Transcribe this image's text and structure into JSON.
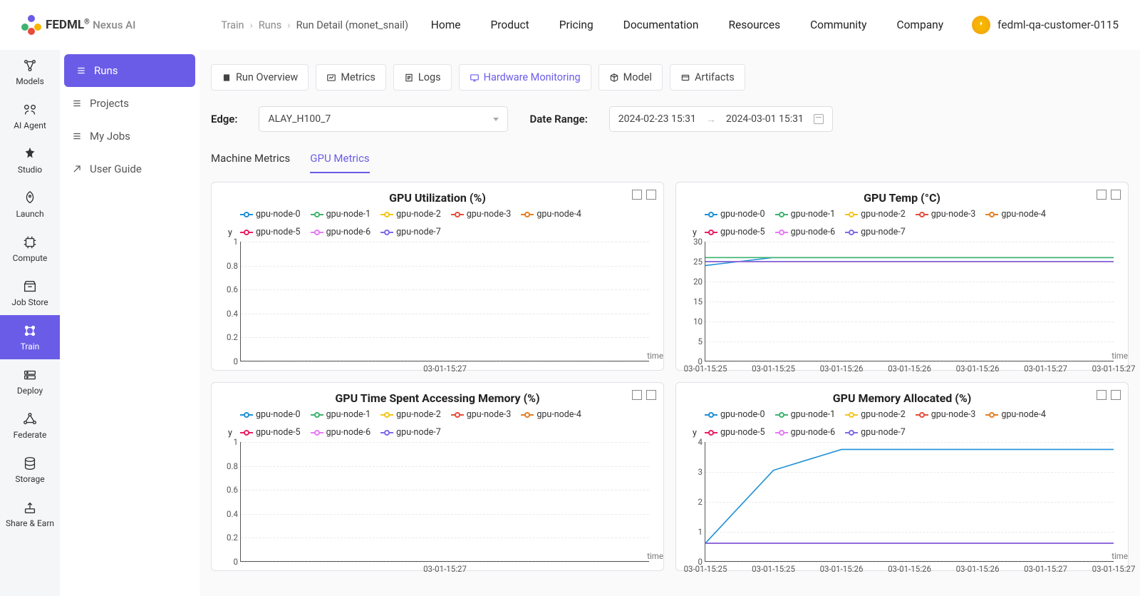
{
  "brand": {
    "name": "FEDML",
    "suffix": "Nexus AI",
    "reg": "®"
  },
  "breadcrumb": {
    "train": "Train",
    "runs": "Runs",
    "current": "Run Detail (monet_snail)"
  },
  "topmenu": [
    "Home",
    "Product",
    "Pricing",
    "Documentation",
    "Resources",
    "Community",
    "Company"
  ],
  "user": {
    "name": "fedml-qa-customer-0115"
  },
  "rail": [
    {
      "label": "Models"
    },
    {
      "label": "AI Agent"
    },
    {
      "label": "Studio"
    },
    {
      "label": "Launch"
    },
    {
      "label": "Compute"
    },
    {
      "label": "Job Store"
    },
    {
      "label": "Train",
      "active": true
    },
    {
      "label": "Deploy"
    },
    {
      "label": "Federate"
    },
    {
      "label": "Storage"
    },
    {
      "label": "Share & Earn"
    }
  ],
  "side2": [
    {
      "label": "Runs",
      "active": true
    },
    {
      "label": "Projects"
    },
    {
      "label": "My Jobs"
    },
    {
      "label": "User Guide"
    }
  ],
  "tabs": [
    {
      "label": "Run Overview"
    },
    {
      "label": "Metrics"
    },
    {
      "label": "Logs"
    },
    {
      "label": "Hardware Monitoring",
      "active": true
    },
    {
      "label": "Model"
    },
    {
      "label": "Artifacts"
    }
  ],
  "filters": {
    "edge_label": "Edge:",
    "edge_value": "ALAY_H100_7",
    "date_label": "Date Range:",
    "date_from": "2024-02-23 15:31",
    "date_to": "2024-03-01 15:31"
  },
  "subtabs": [
    {
      "label": "Machine Metrics"
    },
    {
      "label": "GPU Metrics",
      "active": true
    }
  ],
  "series_colors": {
    "gpu-node-0": "#1e90d6",
    "gpu-node-1": "#3db36f",
    "gpu-node-2": "#f5c518",
    "gpu-node-3": "#e74c3c",
    "gpu-node-4": "#e67e22",
    "gpu-node-5": "#e91e63",
    "gpu-node-6": "#e879f9",
    "gpu-node-7": "#7c6ce8"
  },
  "legend_names": [
    "gpu-node-0",
    "gpu-node-1",
    "gpu-node-2",
    "gpu-node-3",
    "gpu-node-4",
    "gpu-node-5",
    "gpu-node-6",
    "gpu-node-7"
  ],
  "axis_time_label": "time",
  "axis_y_label": "y",
  "chart_data": [
    {
      "id": "gpu_util",
      "title": "GPU Utilization (%)",
      "type": "line",
      "ylim": [
        0,
        1
      ],
      "yticks": [
        0,
        0.2,
        0.4,
        0.6,
        0.8,
        1
      ],
      "x": [
        "03-01-15:27"
      ],
      "series": [
        {
          "name": "gpu-node-0",
          "values": [
            0
          ]
        },
        {
          "name": "gpu-node-1",
          "values": [
            0
          ]
        },
        {
          "name": "gpu-node-2",
          "values": [
            0
          ]
        },
        {
          "name": "gpu-node-3",
          "values": [
            0
          ]
        },
        {
          "name": "gpu-node-4",
          "values": [
            0
          ]
        },
        {
          "name": "gpu-node-5",
          "values": [
            0
          ]
        },
        {
          "name": "gpu-node-6",
          "values": [
            0
          ]
        },
        {
          "name": "gpu-node-7",
          "values": [
            0
          ]
        }
      ]
    },
    {
      "id": "gpu_temp",
      "title": "GPU Temp (°C)",
      "type": "line",
      "ylim": [
        0,
        30
      ],
      "yticks": [
        0,
        5,
        10,
        15,
        20,
        25,
        30
      ],
      "x": [
        "03-01-15:25",
        "03-01-15:25",
        "03-01-15:26",
        "03-01-15:26",
        "03-01-15:26",
        "03-01-15:27",
        "03-01-15:27"
      ],
      "series": [
        {
          "name": "gpu-node-0",
          "values": [
            24,
            26,
            26,
            26,
            26,
            26,
            26
          ]
        },
        {
          "name": "gpu-node-1",
          "values": [
            26,
            26,
            26,
            26,
            26,
            26,
            26
          ]
        },
        {
          "name": "gpu-node-2",
          "values": [
            25,
            25,
            25,
            25,
            25,
            25,
            25
          ]
        },
        {
          "name": "gpu-node-3",
          "values": [
            25,
            25,
            25,
            25,
            25,
            25,
            25
          ]
        },
        {
          "name": "gpu-node-4",
          "values": [
            25,
            25,
            25,
            25,
            25,
            25,
            25
          ]
        },
        {
          "name": "gpu-node-5",
          "values": [
            25,
            25,
            25,
            25,
            25,
            25,
            25
          ]
        },
        {
          "name": "gpu-node-6",
          "values": [
            25,
            25,
            25,
            25,
            25,
            25,
            25
          ]
        },
        {
          "name": "gpu-node-7",
          "values": [
            25,
            25,
            25,
            25,
            25,
            25,
            25
          ]
        }
      ]
    },
    {
      "id": "gpu_mem_time",
      "title": "GPU Time Spent Accessing Memory (%)",
      "type": "line",
      "ylim": [
        0,
        1
      ],
      "yticks": [
        0,
        0.2,
        0.4,
        0.6,
        0.8,
        1
      ],
      "x": [
        "03-01-15:27"
      ],
      "series": [
        {
          "name": "gpu-node-0",
          "values": [
            0
          ]
        },
        {
          "name": "gpu-node-1",
          "values": [
            0
          ]
        },
        {
          "name": "gpu-node-2",
          "values": [
            0
          ]
        },
        {
          "name": "gpu-node-3",
          "values": [
            0
          ]
        },
        {
          "name": "gpu-node-4",
          "values": [
            0
          ]
        },
        {
          "name": "gpu-node-5",
          "values": [
            0
          ]
        },
        {
          "name": "gpu-node-6",
          "values": [
            0
          ]
        },
        {
          "name": "gpu-node-7",
          "values": [
            0
          ]
        }
      ]
    },
    {
      "id": "gpu_mem_alloc",
      "title": "GPU Memory Allocated (%)",
      "type": "line",
      "ylim": [
        0,
        4
      ],
      "yticks": [
        0,
        1,
        2,
        3,
        4
      ],
      "x": [
        "03-01-15:25",
        "03-01-15:25",
        "03-01-15:26",
        "03-01-15:26",
        "03-01-15:26",
        "03-01-15:27",
        "03-01-15:27"
      ],
      "series": [
        {
          "name": "gpu-node-0",
          "values": [
            0.6,
            3.05,
            3.75,
            3.75,
            3.75,
            3.75,
            3.75
          ]
        },
        {
          "name": "gpu-node-1",
          "values": [
            0.6,
            0.6,
            0.6,
            0.6,
            0.6,
            0.6,
            0.6
          ]
        },
        {
          "name": "gpu-node-2",
          "values": [
            0.6,
            0.6,
            0.6,
            0.6,
            0.6,
            0.6,
            0.6
          ]
        },
        {
          "name": "gpu-node-3",
          "values": [
            0.6,
            0.6,
            0.6,
            0.6,
            0.6,
            0.6,
            0.6
          ]
        },
        {
          "name": "gpu-node-4",
          "values": [
            0.6,
            0.6,
            0.6,
            0.6,
            0.6,
            0.6,
            0.6
          ]
        },
        {
          "name": "gpu-node-5",
          "values": [
            0.6,
            0.6,
            0.6,
            0.6,
            0.6,
            0.6,
            0.6
          ]
        },
        {
          "name": "gpu-node-6",
          "values": [
            0.6,
            0.6,
            0.6,
            0.6,
            0.6,
            0.6,
            0.6
          ]
        },
        {
          "name": "gpu-node-7",
          "values": [
            0.6,
            0.6,
            0.6,
            0.6,
            0.6,
            0.6,
            0.6
          ]
        }
      ]
    }
  ]
}
